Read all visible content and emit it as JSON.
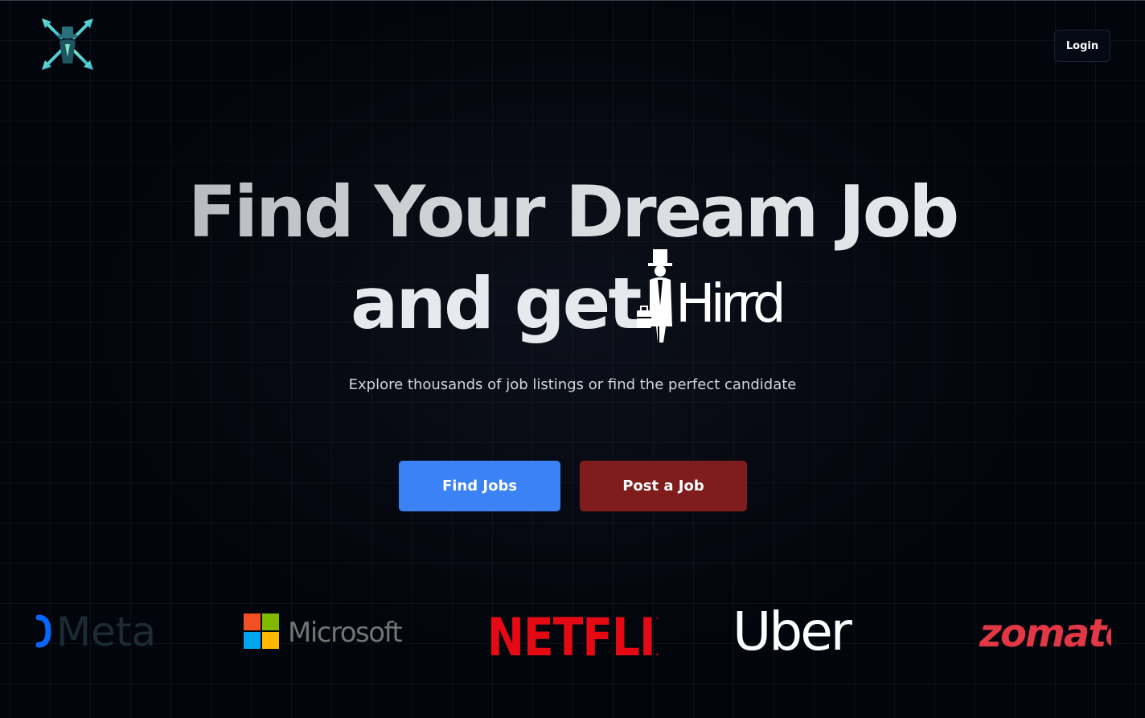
{
  "header": {
    "logo_icon": "hat-figure-logo-icon",
    "login_label": "Login"
  },
  "hero": {
    "title_line1": "Find Your Dream Job",
    "title_line2": "and get",
    "brand_logo_text": "Hirrd",
    "subtitle": "Explore thousands of job listings or find the perfect candidate"
  },
  "actions": {
    "find_jobs_label": "Find Jobs",
    "post_job_label": "Post a Job",
    "find_jobs_color": "#3b82f6",
    "post_job_color": "#7f1d1d"
  },
  "companies": [
    {
      "name": "Meta",
      "color": "#1c2b33",
      "accent": "#0866ff"
    },
    {
      "name": "Microsoft",
      "color": "#737373"
    },
    {
      "name": "NETFLIX",
      "color": "#e50914"
    },
    {
      "name": "Uber",
      "color": "#ffffff"
    },
    {
      "name": "zomato",
      "color": "#e23744"
    }
  ]
}
